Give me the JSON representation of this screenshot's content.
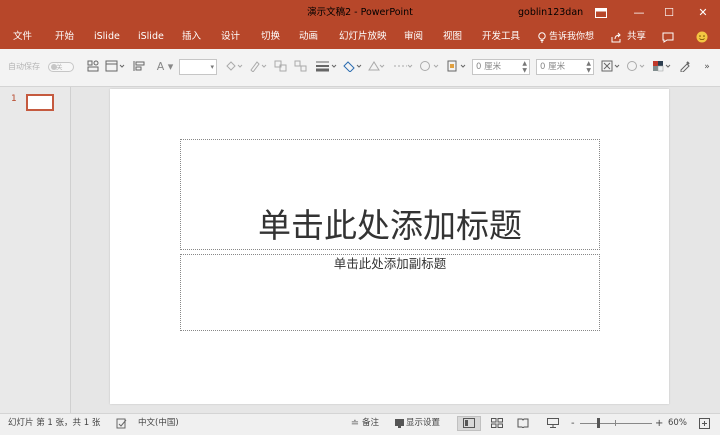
{
  "window": {
    "title": "演示文稿2  -  PowerPoint",
    "user": "goblin123dan",
    "controls": {
      "ribbon_display_icon": "ribbon-display-icon",
      "minimize": "—",
      "maximize": "☐",
      "close": "✕"
    }
  },
  "ribbon": {
    "tabs": [
      "文件",
      "开始",
      "iSlide",
      "iSlide",
      "插入",
      "设计",
      "切换",
      "动画",
      "幻灯片放映",
      "审阅",
      "视图",
      "开发工具"
    ],
    "tell_me": "告诉我你想",
    "share": "共享",
    "comment_icon": "comment-icon",
    "feedback_icon": "smiley-icon"
  },
  "toolbar": {
    "autosave_label": "自动保存",
    "autosave_state": "关",
    "shape_width_value": "0 厘米",
    "shape_height_value": "0 厘米",
    "font_glyph": "A"
  },
  "slides_pane": {
    "slide_number": "1"
  },
  "slide": {
    "title_placeholder": "单击此处添加标题",
    "subtitle_placeholder": "单击此处添加副标题"
  },
  "status": {
    "slide_info": "幻灯片 第 1 张，共 1 张",
    "language": "中文(中国)",
    "notes": "备注",
    "display_settings": "显示设置",
    "zoom_minus": "-",
    "zoom_plus": "+",
    "zoom": "60%",
    "zoom_level": 0.6
  },
  "colors": {
    "accent": "#b7472a",
    "thumb_border": "#c55a3f"
  }
}
